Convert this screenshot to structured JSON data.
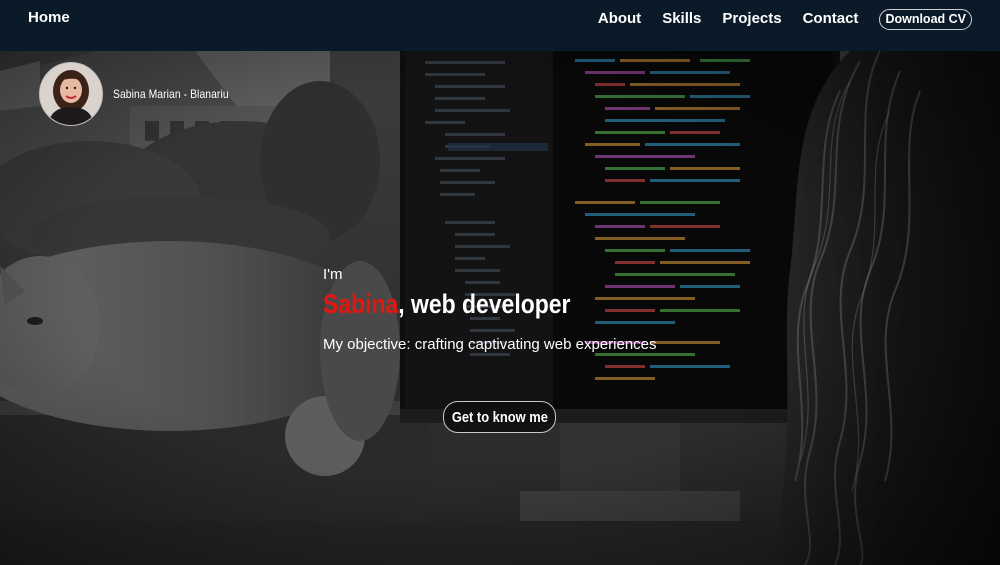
{
  "nav": {
    "home": "Home",
    "links": [
      "About",
      "Skills",
      "Projects",
      "Contact"
    ],
    "download_cv": "Download CV"
  },
  "profile": {
    "name": "Sabina Marian - Blanariu"
  },
  "hero": {
    "greeting": "I'm",
    "first_name": "Sabina",
    "role": ", web developer",
    "objective": "My objective: crafting captivating web experiences",
    "cta": "Get to know me"
  },
  "colors": {
    "navbar_bg": "#0a1a28",
    "accent_name": "#e8140e",
    "text": "#ffffff"
  }
}
